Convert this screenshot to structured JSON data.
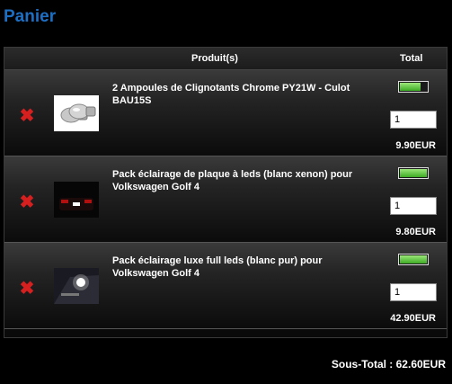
{
  "page": {
    "title": "Panier"
  },
  "cart": {
    "headers": {
      "product": "Produit(s)",
      "total": "Total"
    },
    "items": [
      {
        "name": "2 Ampoules de Clignotants Chrome PY21W - Culot BAU15S",
        "quantity": "1",
        "price": "9.90EUR"
      },
      {
        "name": "Pack éclairage de plaque à leds (blanc xenon) pour Volkswagen Golf 4",
        "quantity": "1",
        "price": "9.80EUR"
      },
      {
        "name": "Pack éclairage luxe full leds (blanc pur) pour Volkswagen Golf 4",
        "quantity": "1",
        "price": "42.90EUR"
      }
    ],
    "subtotal": "Sous-Total : 62.60EUR"
  },
  "colors": {
    "title": "#1d6fc4",
    "remove": "#d62020",
    "toggle_fill": "#5bc43a"
  }
}
